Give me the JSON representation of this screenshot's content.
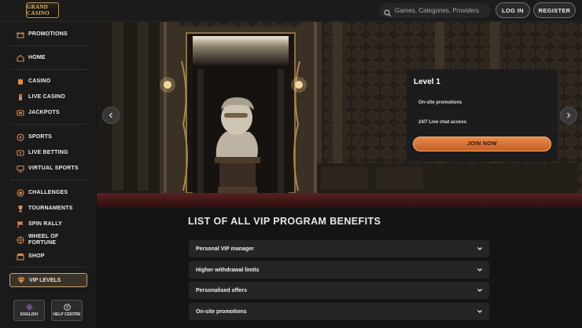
{
  "header": {
    "logo_text": "GRAND CASINO",
    "search_placeholder": "Games, Categories, Providers",
    "login_label": "LOG IN",
    "register_label": "REGISTER"
  },
  "sidebar": {
    "items": [
      {
        "label": "PROMOTIONS",
        "icon": "gift-icon"
      },
      {
        "label": "HOME",
        "icon": "home-icon"
      },
      {
        "label": "CASINO",
        "icon": "casino-icon"
      },
      {
        "label": "LIVE CASINO",
        "icon": "live-casino-icon"
      },
      {
        "label": "JACKPOTS",
        "icon": "jackpot-icon"
      },
      {
        "label": "SPORTS",
        "icon": "ball-icon"
      },
      {
        "label": "LIVE BETTING",
        "icon": "live-betting-icon"
      },
      {
        "label": "VIRTUAL SPORTS",
        "icon": "virtual-sports-icon"
      },
      {
        "label": "CHALLENGES",
        "icon": "challenge-icon"
      },
      {
        "label": "TOURNAMENTS",
        "icon": "trophy-icon"
      },
      {
        "label": "SPIN RALLY",
        "icon": "flag-icon"
      },
      {
        "label_line1": "WHEEL OF",
        "label_line2": "FORTUNE",
        "icon": "wheel-icon"
      },
      {
        "label": "SHOP",
        "icon": "shop-icon"
      }
    ],
    "vip_label": "VIP LEVELS",
    "language_label": "ENGLISH",
    "help_label": "HELP CENTRE"
  },
  "hero": {
    "level_title": "Level 1",
    "benefits": [
      "On-site promotions",
      "24/7 Live chat access"
    ],
    "join_label": "JOIN NOW"
  },
  "benefits_section": {
    "title": "LIST OF ALL VIP PROGRAM BENEFITS",
    "rows": [
      "Personal VIP manager",
      "Higher withdrawal limits",
      "Personalised offers",
      "On-site promotions"
    ]
  },
  "colors": {
    "accent_gold": "#c9a06a",
    "join_orange": "#e07a3c",
    "background": "#141414",
    "sidebar_bg": "#1a1a1a",
    "nav_icon_orange": "#e08a4a"
  }
}
